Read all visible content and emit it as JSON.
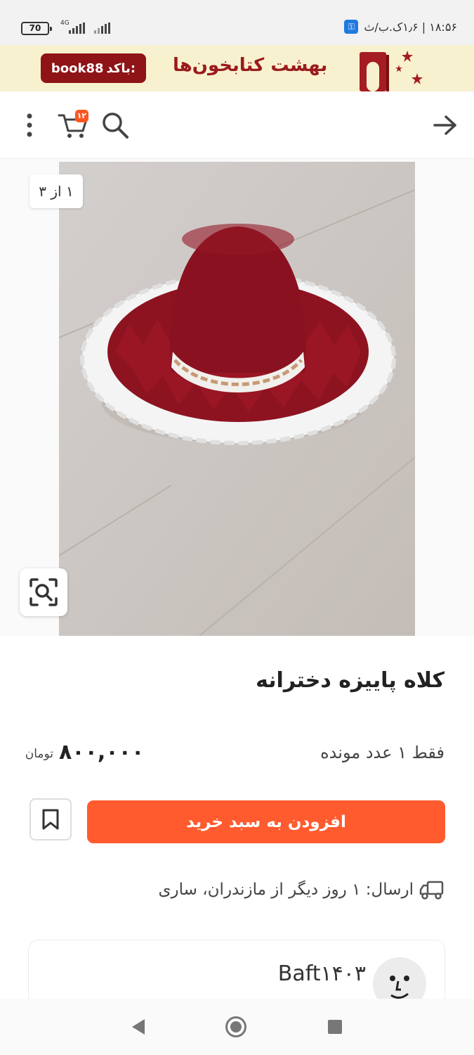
{
  "status_bar": {
    "battery": "70",
    "network": "4G",
    "time_info": "۱۸:۵۶ | ۱٫۶ک.ب/ث"
  },
  "banner": {
    "code_label": "باکد:",
    "code_value": "book88",
    "title": "بهشت کتابخون‌ها"
  },
  "header": {
    "cart_count": "۱۲"
  },
  "gallery": {
    "counter": "۱ از ۳"
  },
  "product": {
    "title": "کلاه پاییزه دخترانه",
    "stock": "فقط ۱ عدد مونده",
    "price": "۸۰۰,۰۰۰",
    "currency": "تومان",
    "add_to_cart": "افزودن به سبد خرید",
    "shipping": "ارسال: ۱ روز دیگر از مازندران، ساری"
  },
  "seller": {
    "name": "Baft۱۴۰۳"
  },
  "colors": {
    "accent": "#ff5b2e",
    "banner_bg": "#f8f1cf",
    "brand_red": "#8e1417"
  }
}
